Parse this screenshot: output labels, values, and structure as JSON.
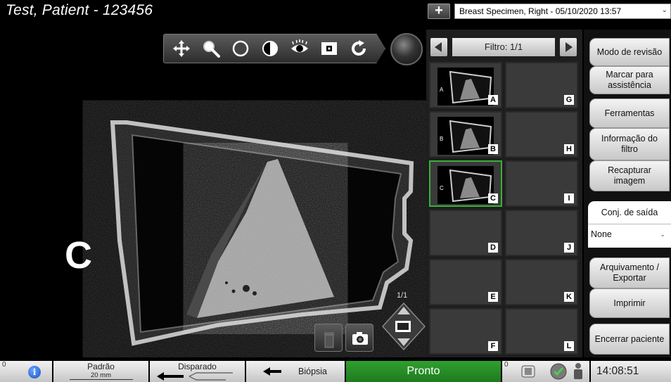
{
  "window": {
    "title": "Test, Patient - 123456",
    "add_label": "+",
    "study_selector": "Breast Specimen, Right - 05/10/2020 13:57"
  },
  "viewer": {
    "view_letter": "C",
    "page_count": "1/1",
    "toolbar": [
      "pan-icon",
      "zoom-icon",
      "magnifier-circle-icon",
      "contrast-icon",
      "eye-icon",
      "invert-icon",
      "reset-icon"
    ]
  },
  "thumbnails": {
    "filter_label": "Filtro: 1/1",
    "items": [
      {
        "letter": "A",
        "has_image": true,
        "selected": false
      },
      {
        "letter": "B",
        "has_image": true,
        "selected": false
      },
      {
        "letter": "C",
        "has_image": true,
        "selected": true
      },
      {
        "letter": "D",
        "has_image": false,
        "selected": false
      },
      {
        "letter": "E",
        "has_image": false,
        "selected": false
      },
      {
        "letter": "F",
        "has_image": false,
        "selected": false
      },
      {
        "letter": "G",
        "has_image": false,
        "selected": false
      },
      {
        "letter": "H",
        "has_image": false,
        "selected": false
      },
      {
        "letter": "I",
        "has_image": false,
        "selected": false
      },
      {
        "letter": "J",
        "has_image": false,
        "selected": false
      },
      {
        "letter": "K",
        "has_image": false,
        "selected": false
      },
      {
        "letter": "L",
        "has_image": false,
        "selected": false
      }
    ]
  },
  "menu": {
    "review_mode": "Modo de revisão",
    "mark_assist": "Marcar para assistência",
    "tools": "Ferramentas",
    "filter_info": "Informação do filtro",
    "recapture": "Recapturar imagem",
    "output_set_label": "Conj. de saída",
    "output_set_value": "None",
    "archive_export": "Arquivamento / Exportar",
    "print": "Imprimir",
    "close_patient": "Encerrar paciente"
  },
  "statusbar": {
    "count_left": "0",
    "padrao_label": "Padrão",
    "padrao_value": "20 mm",
    "disparado_label": "Disparado",
    "biopsia_label": "Biópsia",
    "ready": "Pronto",
    "count_right": "0",
    "time": "14:08:51"
  },
  "colors": {
    "ready_green": "#2a922a",
    "selected_border": "#38b038"
  }
}
